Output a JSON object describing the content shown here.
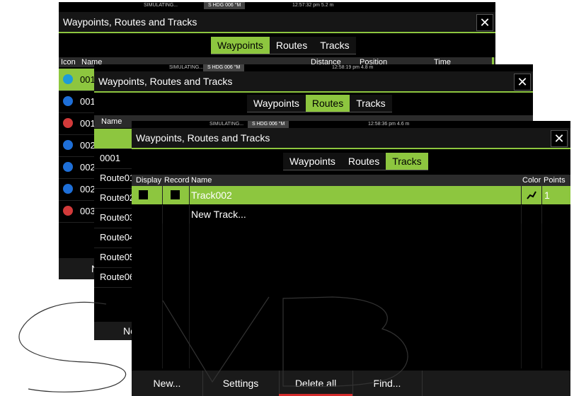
{
  "win1": {
    "status": {
      "sim": "SIMULATING...",
      "hdg": "S HDG 006 °M",
      "clock": "12:57:32 pm  5.2 m"
    },
    "title": "Waypoints, Routes and Tracks",
    "close": "✕",
    "tabs": [
      "Waypoints",
      "Routes",
      "Tracks"
    ],
    "active_tab": 0,
    "headers": {
      "icon": "Icon",
      "name": "Name",
      "distance": "Distance",
      "position": "Position",
      "time": "Time"
    },
    "rows": [
      {
        "name": "001",
        "icon": "cross-waypoint-icon",
        "color": "#1e9bd8"
      },
      {
        "name": "001",
        "icon": "cross-waypoint-icon",
        "color": "#1e6fd8"
      },
      {
        "name": "001",
        "icon": "boat-icon",
        "color": "#d23a3a"
      },
      {
        "name": "002",
        "icon": "diamond-waypoint-icon",
        "color": "#1e6fd8"
      },
      {
        "name": "002",
        "icon": "cross-waypoint-icon",
        "color": "#1e6fd8"
      },
      {
        "name": "002",
        "icon": "cross-waypoint-icon",
        "color": "#1e6fd8"
      },
      {
        "name": "003",
        "icon": "boat-icon",
        "color": "#d23a3a"
      }
    ],
    "bottom_new": "New"
  },
  "win2": {
    "status": {
      "sim": "SIMULATING...",
      "hdg": "S HDG 006 °M",
      "clock": "12:58:19 pm  4.8 m"
    },
    "title": "Waypoints, Routes and Tracks",
    "close": "✕",
    "tabs": [
      "Waypoints",
      "Routes",
      "Tracks"
    ],
    "active_tab": 1,
    "headers": {
      "name": "Name"
    },
    "rows": [
      "",
      "0001",
      "Route01",
      "Route02",
      "Route03",
      "Route04",
      "Route05",
      "Route06"
    ],
    "bottom_new": "Ne"
  },
  "win3": {
    "status": {
      "sim": "SIMULATING...",
      "hdg": "S HDG 006 °M",
      "clock": "12:58:36 pm  4.6 m"
    },
    "title": "Waypoints, Routes and Tracks",
    "close": "✕",
    "tabs": [
      "Waypoints",
      "Routes",
      "Tracks"
    ],
    "active_tab": 2,
    "headers": {
      "display": "Display",
      "record": "Record",
      "name": "Name",
      "color": "Color",
      "points": "Points"
    },
    "tracks": [
      {
        "name": "Track002",
        "points": "1",
        "display": true,
        "record": true
      }
    ],
    "new_track": "New Track...",
    "bottom": [
      "New...",
      "Settings",
      "Delete all",
      "Find..."
    ]
  },
  "colors": {
    "accent": "#8dc63f",
    "background": "#000000",
    "header": "#2b2b2b"
  }
}
